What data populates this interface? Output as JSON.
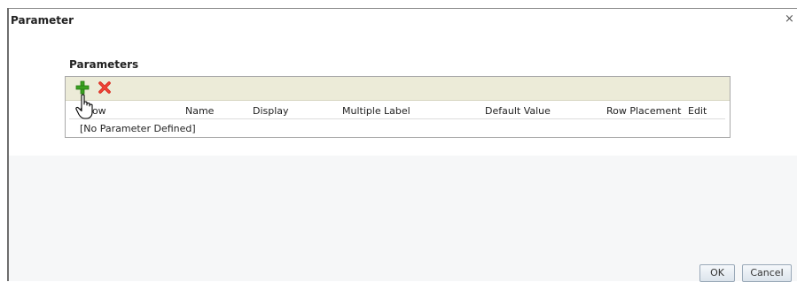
{
  "dialog": {
    "title": "Parameter",
    "close_glyph": "×"
  },
  "parameters": {
    "section_title": "Parameters",
    "toolbar": {
      "add_icon": "add-plus-icon",
      "delete_icon": "delete-x-icon"
    },
    "columns": [
      "Show",
      "Name",
      "Display",
      "Multiple",
      "Label",
      "Default Value",
      "Row Placement",
      "Edit"
    ],
    "empty_message": "[No Parameter Defined]"
  },
  "buttons": {
    "ok_label": "OK",
    "cancel_label": "Cancel"
  },
  "colors": {
    "toolbar_bg": "#ecebd8",
    "add_green": "#3aa021",
    "delete_red": "#d8281c"
  }
}
